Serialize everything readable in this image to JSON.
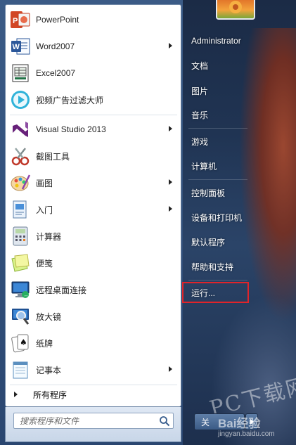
{
  "programs": [
    {
      "label": "PowerPoint",
      "icon": "powerpoint-icon",
      "submenu": false
    },
    {
      "label": "Word2007",
      "icon": "word-icon",
      "submenu": true
    },
    {
      "label": "Excel2007",
      "icon": "excel-icon",
      "submenu": false
    },
    {
      "label": "视频广告过滤大师",
      "icon": "video-ad-filter-icon",
      "submenu": false
    },
    {
      "label": "Visual Studio 2013",
      "icon": "visual-studio-icon",
      "submenu": true
    },
    {
      "label": "截图工具",
      "icon": "snipping-tool-icon",
      "submenu": false
    },
    {
      "label": "画图",
      "icon": "paint-icon",
      "submenu": true
    },
    {
      "label": "入门",
      "icon": "getting-started-icon",
      "submenu": true
    },
    {
      "label": "计算器",
      "icon": "calculator-icon",
      "submenu": false
    },
    {
      "label": "便笺",
      "icon": "sticky-notes-icon",
      "submenu": false
    },
    {
      "label": "远程桌面连接",
      "icon": "remote-desktop-icon",
      "submenu": false
    },
    {
      "label": "放大镜",
      "icon": "magnifier-icon",
      "submenu": false
    },
    {
      "label": "纸牌",
      "icon": "solitaire-icon",
      "submenu": false
    },
    {
      "label": "记事本",
      "icon": "notepad-icon",
      "submenu": true
    }
  ],
  "all_programs_label": "所有程序",
  "search": {
    "placeholder": "搜索程序和文件"
  },
  "right_pane": {
    "user": "Administrator",
    "items": [
      "文档",
      "图片",
      "音乐",
      "游戏",
      "计算机",
      "控制面板",
      "设备和打印机",
      "默认程序",
      "帮助和支持",
      "运行..."
    ],
    "highlighted": "运行..."
  },
  "shutdown_label": "关",
  "watermark": {
    "site": "PC下载网",
    "baidu": "Bai经验",
    "url": "jingyan.baidu.com"
  },
  "colors": {
    "highlight": "#e0242a",
    "pane": "#ffffff"
  }
}
